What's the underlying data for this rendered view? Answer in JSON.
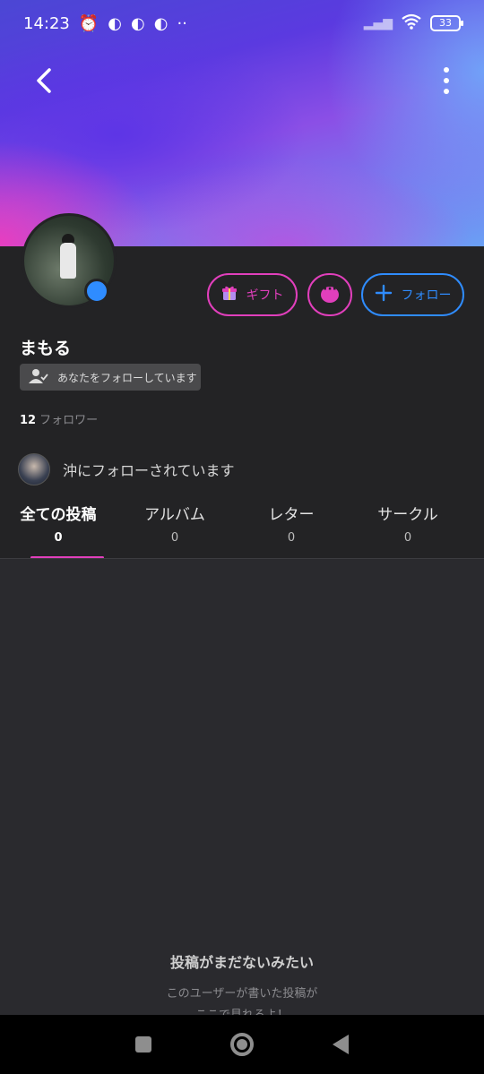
{
  "status_bar": {
    "time": "14:23",
    "battery": "33"
  },
  "profile": {
    "username": "まもる",
    "follows_you_label": "あなたをフォローしています",
    "follower_count": "12",
    "follower_label": "フォロワー",
    "mutual_text": "沖にフォローされています"
  },
  "actions": {
    "gift_label": "ギフト",
    "follow_label": "フォロー"
  },
  "tabs": [
    {
      "label": "全ての投稿",
      "count": "0",
      "active": true
    },
    {
      "label": "アルバム",
      "count": "0"
    },
    {
      "label": "レター",
      "count": "0"
    },
    {
      "label": "サークル",
      "count": "0"
    }
  ],
  "empty_state": {
    "title": "投稿がまだないみたい",
    "line1": "このユーザーが書いた投稿が",
    "line2": "ここで見れるよ！"
  },
  "colors": {
    "accent_pink": "#e13fbc",
    "accent_blue": "#2f8cff",
    "background": "#2a2a2e"
  }
}
